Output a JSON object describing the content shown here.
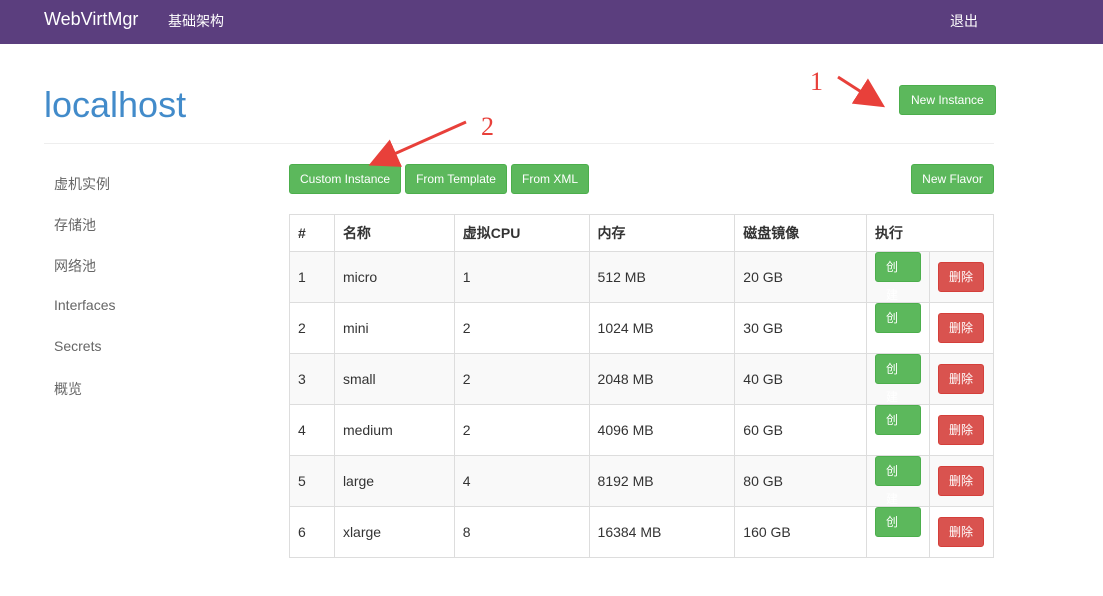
{
  "navbar": {
    "brand": "WebVirtMgr",
    "link_infrastructure": "基础架构",
    "logout": "退出"
  },
  "page": {
    "title": "localhost"
  },
  "buttons": {
    "new_instance": "New Instance",
    "custom_instance": "Custom Instance",
    "from_template": "From Template",
    "from_xml": "From XML",
    "new_flavor": "New Flavor"
  },
  "sidebar": {
    "items": [
      {
        "label": "虚机实例"
      },
      {
        "label": "存储池"
      },
      {
        "label": "网络池"
      },
      {
        "label": "Interfaces"
      },
      {
        "label": "Secrets"
      },
      {
        "label": "概览"
      }
    ]
  },
  "table": {
    "headers": [
      "#",
      "名称",
      "虚拟CPU",
      "内存",
      "磁盘镜像",
      "执行"
    ],
    "create_label": "创建",
    "delete_label": "删除",
    "rows": [
      {
        "id": "1",
        "name": "micro",
        "vcpu": "1",
        "memory": "512 MB",
        "disk": "20 GB"
      },
      {
        "id": "2",
        "name": "mini",
        "vcpu": "2",
        "memory": "1024 MB",
        "disk": "30 GB"
      },
      {
        "id": "3",
        "name": "small",
        "vcpu": "2",
        "memory": "2048 MB",
        "disk": "40 GB"
      },
      {
        "id": "4",
        "name": "medium",
        "vcpu": "2",
        "memory": "4096 MB",
        "disk": "60 GB"
      },
      {
        "id": "5",
        "name": "large",
        "vcpu": "4",
        "memory": "8192 MB",
        "disk": "80 GB"
      },
      {
        "id": "6",
        "name": "xlarge",
        "vcpu": "8",
        "memory": "16384 MB",
        "disk": "160 GB"
      }
    ]
  },
  "annotations": {
    "marker_1": "1",
    "marker_2": "2",
    "color": "#e8403a"
  },
  "colors": {
    "navbar": "#5b3e7e",
    "title": "#428bca",
    "success": "#5cb85c",
    "danger": "#d9534f"
  }
}
